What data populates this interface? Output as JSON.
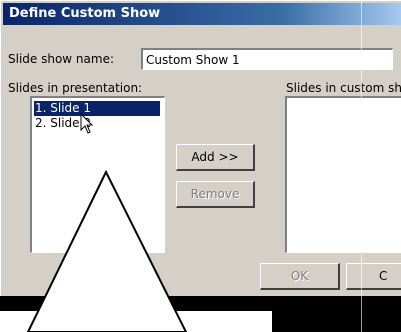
{
  "window": {
    "title": "Define Custom Show"
  },
  "form": {
    "slide_show_name_label": "Slide show name:",
    "slide_show_name_value": "Custom Show 1"
  },
  "slides_in_presentation": {
    "label": "Slides in presentation:",
    "items": [
      {
        "label": "1. Slide 1",
        "selected": true
      },
      {
        "label": "2. Slide 2",
        "selected": false
      }
    ]
  },
  "slides_in_custom_show": {
    "label": "Slides in custom sh",
    "items": []
  },
  "buttons": {
    "add": "Add >>",
    "remove": "Remove",
    "ok": "OK",
    "cancel": "C"
  },
  "colors": {
    "titlebar": "#0a246a",
    "selection": "#0a246a",
    "dialog_face": "#d4d0c8"
  },
  "icons": {
    "cursor": "pointer-arrow-icon"
  }
}
